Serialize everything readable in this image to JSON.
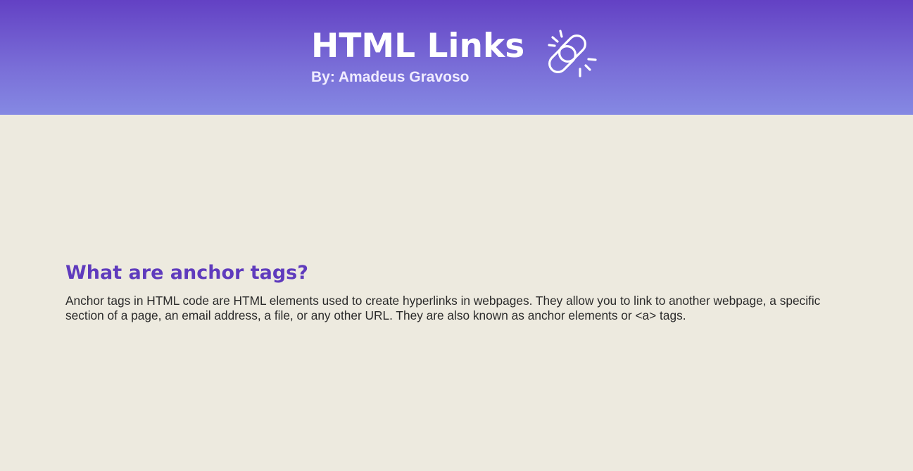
{
  "header": {
    "title": "HTML Links",
    "subtitle": "By: Amadeus Gravoso",
    "icon": "broken-chain-link-icon",
    "gradient_top": "#6341c4",
    "gradient_bottom": "#8589e3"
  },
  "section": {
    "title": "What are anchor tags?",
    "text": "Anchor tags in HTML code are HTML elements used to create hyperlinks in webpages. They allow you to link to another webpage, a specific section of a page, an email address, a file, or any other URL. They are also known as anchor elements or <a> tags.",
    "title_color": "#5f3bbd"
  },
  "page": {
    "background": "#edeadf"
  }
}
